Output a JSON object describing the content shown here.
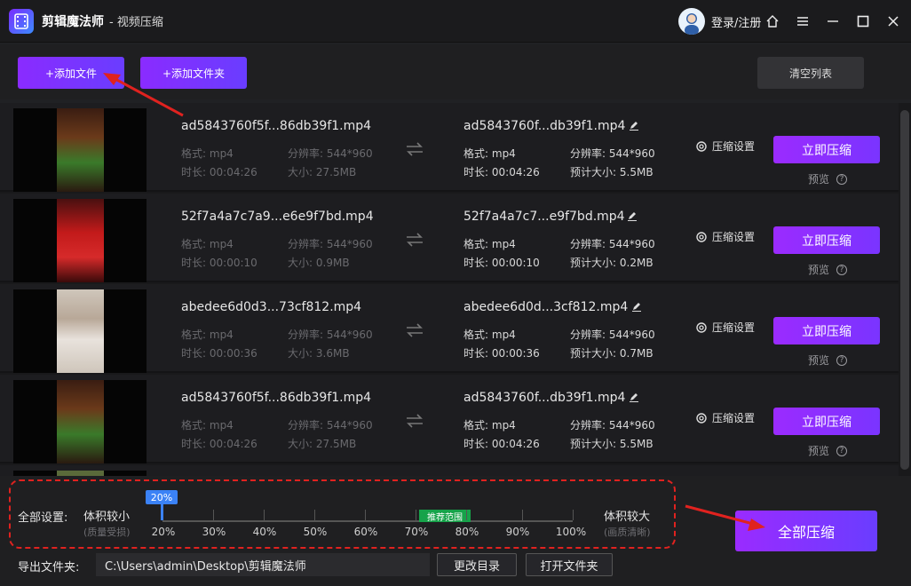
{
  "app": {
    "title": "剪辑魔法师",
    "subtitle": "- 视频压缩",
    "login": "登录/注册"
  },
  "toolbar": {
    "add_file": "+添加文件",
    "add_folder": "+添加文件夹",
    "clear": "清空列表"
  },
  "labels": {
    "format": "格式:",
    "resolution": "分辨率:",
    "duration": "时长:",
    "size": "大小:",
    "est_size": "预计大小:",
    "settings": "压缩设置",
    "compress": "立即压缩",
    "preview": "预览"
  },
  "files": [
    {
      "source": "ad5843760f5f...86db39f1.mp4",
      "output": "ad5843760f...db39f1.mp4",
      "format": "mp4",
      "resolution": "544*960",
      "duration": "00:04:26",
      "size": "27.5MB",
      "out_format": "mp4",
      "out_resolution": "544*960",
      "out_duration": "00:04:26",
      "est_size": "5.5MB"
    },
    {
      "source": "52f7a4a7c7a9...e6e9f7bd.mp4",
      "output": "52f7a4a7c7...e9f7bd.mp4",
      "format": "mp4",
      "resolution": "544*960",
      "duration": "00:00:10",
      "size": "0.9MB",
      "out_format": "mp4",
      "out_resolution": "544*960",
      "out_duration": "00:00:10",
      "est_size": "0.2MB"
    },
    {
      "source": "abedee6d0d3...73cf812.mp4",
      "output": "abedee6d0d...3cf812.mp4",
      "format": "mp4",
      "resolution": "544*960",
      "duration": "00:00:36",
      "size": "3.6MB",
      "out_format": "mp4",
      "out_resolution": "544*960",
      "out_duration": "00:00:36",
      "est_size": "0.7MB"
    },
    {
      "source": "ad5843760f5f...86db39f1.mp4",
      "output": "ad5843760f...db39f1.mp4",
      "format": "mp4",
      "resolution": "544*960",
      "duration": "00:04:26",
      "size": "27.5MB",
      "out_format": "mp4",
      "out_resolution": "544*960",
      "out_duration": "00:04:26",
      "est_size": "5.5MB"
    }
  ],
  "bottom": {
    "all_settings": "全部设置:",
    "smaller": "体积较小",
    "smaller_note": "(质量受损)",
    "larger": "体积较大",
    "larger_note": "(画质清晰)",
    "slider_value": "20%",
    "recommend": "推荐范围",
    "ticks": [
      "20%",
      "30%",
      "40%",
      "50%",
      "60%",
      "70%",
      "80%",
      "90%",
      "100%"
    ],
    "compress_all": "全部压缩",
    "export_label": "导出文件夹:",
    "export_path": "C:\\Users\\admin\\Desktop\\剪辑魔法师",
    "change_dir": "更改目录",
    "open_folder": "打开文件夹"
  },
  "colors": {
    "accent": "#8a2bff",
    "slider": "#3b82f6",
    "recommend": "#16a34a",
    "annotation": "#e0221f"
  }
}
